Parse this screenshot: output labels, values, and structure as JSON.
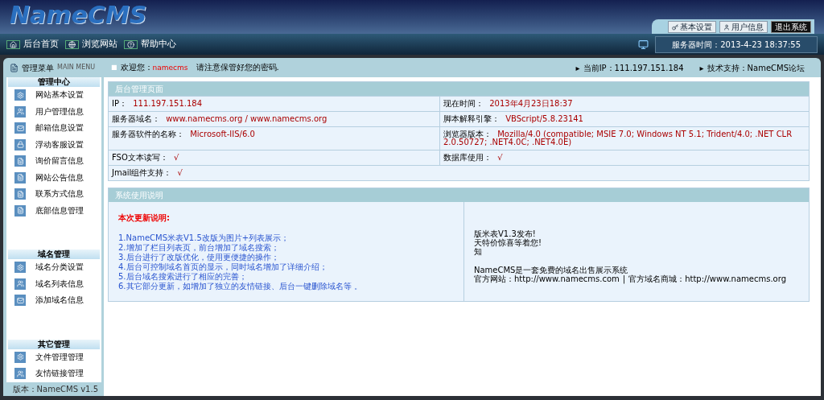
{
  "header": {
    "logo": "NameCMS",
    "buttons": [
      {
        "label": "基本设置",
        "kind": "light"
      },
      {
        "label": "用户信息",
        "kind": "light"
      },
      {
        "label": "退出系统",
        "kind": "dark"
      }
    ]
  },
  "nav": {
    "links": [
      {
        "label": "后台首页"
      },
      {
        "label": "浏览网站"
      },
      {
        "label": "帮助中心"
      }
    ],
    "server_time": "服务器时间：2013-4-23 18:37:55"
  },
  "menu_bar": {
    "title": "管理菜单",
    "subtitle": "MAIN MENU",
    "bullet": "■",
    "arrow": "▸",
    "welcome": "欢迎您：",
    "user": "namecms",
    "notice": "请注意保管好您的密码.",
    "ip": "当前IP：111.197.151.184",
    "support": "技术支持：NameCMS论坛"
  },
  "sidebar": {
    "sections": [
      {
        "title": "管理中心",
        "items": [
          "网站基本设置",
          "用户管理信息",
          "邮箱信息设置",
          "浮动客服设置",
          "询价留言信息",
          "网站公告信息",
          "联系方式信息",
          "底部信息管理"
        ]
      },
      {
        "title": "域名管理",
        "items": [
          "域名分类设置",
          "域名列表信息",
          "添加域名信息"
        ]
      },
      {
        "title": "其它管理",
        "items": [
          "文件管理管理",
          "友情链接管理"
        ]
      }
    ],
    "version": "版本：NameCMS v1.5"
  },
  "info_panel": {
    "title": "后台管理页面",
    "rows": [
      [
        {
          "label": "IP：",
          "value": "111.197.151.184"
        },
        {
          "label": "现在时间：",
          "value": "2013年4月23日18:37"
        }
      ],
      [
        {
          "label": "服务器域名：",
          "value": "www.namecms.org / www.namecms.org"
        },
        {
          "label": "脚本解释引擎：",
          "value": "VBScript/5.8.23141"
        }
      ],
      [
        {
          "label": "服务器软件的名称：",
          "value": "Microsoft-IIS/6.0"
        },
        {
          "label": "浏览器版本：",
          "value": "Mozilla/4.0 (compatible; MSIE 7.0; Windows NT 5.1; Trident/4.0; .NET CLR 2.0.50727; .NET4.0C; .NET4.0E)"
        }
      ],
      [
        {
          "label": "FSO文本读写：",
          "value": "√"
        },
        {
          "label": "数据库使用：",
          "value": "√"
        }
      ],
      [
        {
          "label": "Jmail组件支持：",
          "value": "√"
        }
      ]
    ]
  },
  "usage_panel": {
    "title": "系统使用说明",
    "heading": "本次更新说明:",
    "updates": [
      "1.NameCMS米表V1.5改版为图片+列表展示；",
      "2.增加了栏目列表页，前台增加了域名搜索；",
      "3.后台进行了改版优化，使用更便捷的操作；",
      "4.后台可控制域名首页的显示，同时域名增加了详细介绍；",
      "5.后台域名搜索进行了相应的完善；",
      "6.其它部分更新，如增加了独立的友情链接、后台一键删除域名等 。"
    ],
    "news": [
      "版米表V1.3发布!",
      "天特价惊喜等着您!",
      "知"
    ],
    "about": "NameCMS是一套免费的域名出售展示系统",
    "site_label": "官方网站：",
    "site_url": "http://www.namecms.com",
    "separator": "|",
    "shop_label": "官方域名商城：",
    "shop_url": "http://www.namecms.org"
  }
}
